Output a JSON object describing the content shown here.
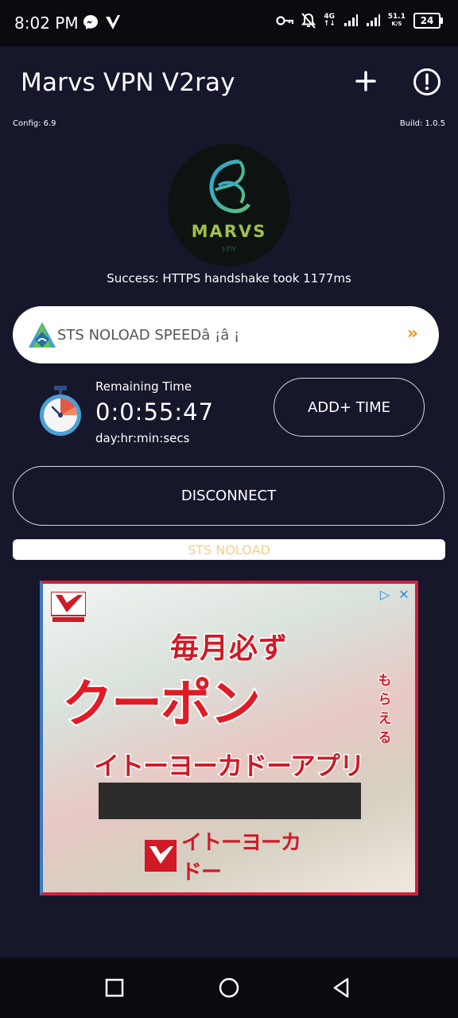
{
  "status_bar": {
    "time": "8:02 PM",
    "network": "4G",
    "speed_value": "51.1",
    "speed_unit": "K/S",
    "battery": "24",
    "icons": [
      "messenger-icon",
      "v-app-icon",
      "key-icon",
      "bell-off-icon",
      "signal-icon",
      "signal-icon",
      "battery-icon"
    ]
  },
  "app_bar": {
    "title": "Marvs VPN V2ray",
    "actions": [
      "add-icon",
      "info-icon"
    ]
  },
  "meta": {
    "config": "Config: 6.9",
    "build": "Build: 1.0.5"
  },
  "logo": {
    "word": "MARVS",
    "sub": "VPN"
  },
  "status_message": "Success: HTTPS handshake took 1177ms",
  "server": {
    "name": "STS NOLOAD SPEEDâ ¡â ¡",
    "chevron": "»"
  },
  "timer": {
    "label": "Remaining Time",
    "value": "0:0:55:47",
    "unit": "day:hr:min:secs",
    "add_button": "ADD+ TIME"
  },
  "disconnect_button": "DISCONNECT",
  "notice": "STS NOLOAD",
  "ad": {
    "line1": "毎月必ず",
    "line2": "クーポン",
    "side": "もらえる",
    "line3": "イトーヨーカドーアプリ",
    "brand": "イトーヨーカドー",
    "choices_glyph": "▷",
    "close_glyph": "✕",
    "colors": {
      "red": "#d01a27",
      "blue": "#3a79c5"
    }
  },
  "nav_bar": {
    "buttons": [
      "recents-icon",
      "home-icon",
      "back-icon"
    ]
  }
}
